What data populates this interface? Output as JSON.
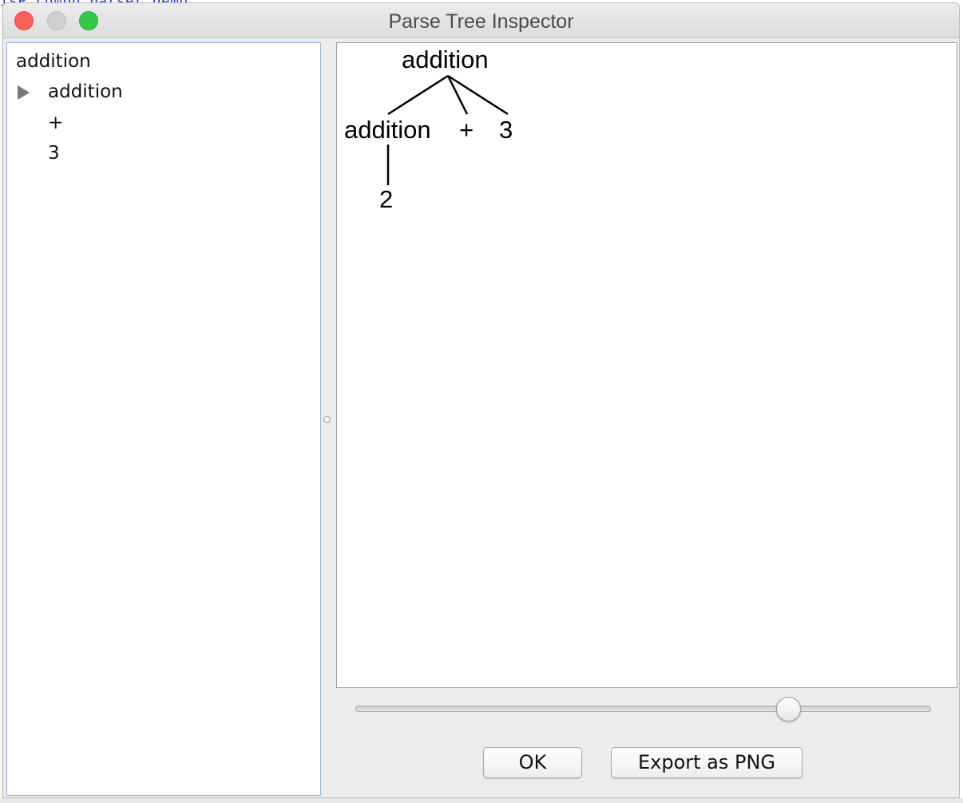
{
  "background": {
    "code_text": "isP.combb.parser.Demo"
  },
  "window": {
    "title": "Parse Tree Inspector"
  },
  "tree": {
    "root_label": "addition",
    "children": [
      {
        "label": "addition",
        "expandable": true,
        "expanded": false
      },
      {
        "label": "+"
      },
      {
        "label": "3"
      }
    ]
  },
  "parse_tree": {
    "root": "addition",
    "level1": [
      "addition",
      "+",
      "3"
    ],
    "level2": [
      "2"
    ]
  },
  "zoom_slider": {
    "value_fraction": 0.75
  },
  "buttons": {
    "ok_label": "OK",
    "export_label": "Export as PNG"
  },
  "colors": {
    "close": "#fc605b",
    "minimize": "#d0d0d0",
    "maximize": "#34c84a",
    "tree_focus_border": "#8cb6e0"
  }
}
